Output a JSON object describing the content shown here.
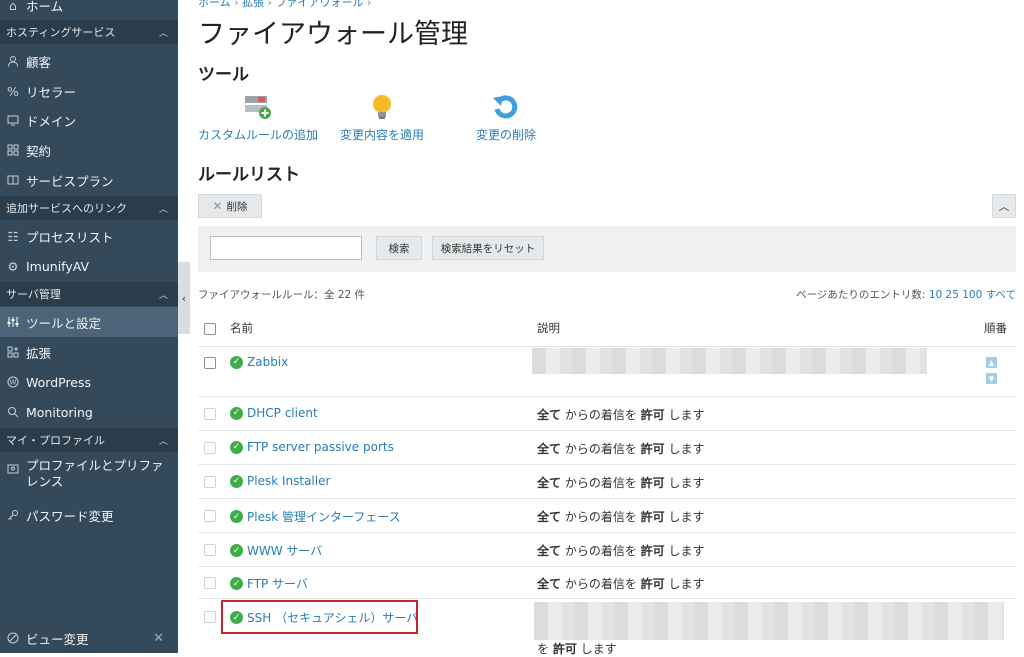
{
  "sidebar": {
    "top_item": "ホーム",
    "sections": [
      {
        "label": "ホスティングサービス"
      },
      {
        "label": "追加サービスへのリンク"
      },
      {
        "label": "サーバ管理"
      },
      {
        "label": "マイ・プロファイル"
      }
    ],
    "items": [
      {
        "label": "顧客",
        "icon": "user-icon"
      },
      {
        "label": "リセラー",
        "icon": "percent-icon"
      },
      {
        "label": "ドメイン",
        "icon": "monitor-icon"
      },
      {
        "label": "契約",
        "icon": "grid-icon"
      },
      {
        "label": "サービスプラン",
        "icon": "book-icon"
      },
      {
        "label": "プロセスリスト",
        "icon": "list-icon"
      },
      {
        "label": "ImunifyAV",
        "icon": "gear-icon"
      },
      {
        "label": "ツールと設定",
        "icon": "sliders-icon"
      },
      {
        "label": "拡張",
        "icon": "extensions-icon"
      },
      {
        "label": "WordPress",
        "icon": "wordpress-icon"
      },
      {
        "label": "Monitoring",
        "icon": "monitoring-icon"
      },
      {
        "label": "プロファイルとプリファ",
        "label2": "レンス",
        "icon": "profile-icon"
      },
      {
        "label": "パスワード変更",
        "icon": "key-icon"
      }
    ],
    "bottom_item": "ビュー変更"
  },
  "breadcrumb": [
    "ホーム",
    "拡張",
    "ファイアウォール"
  ],
  "page_title": "ファイアウォール管理",
  "tools_heading": "ツール",
  "tools": [
    {
      "label": "カスタムルールの追加",
      "icon": "add-rule-icon"
    },
    {
      "label": "変更内容を適用",
      "icon": "lightbulb-icon"
    },
    {
      "label": "変更の削除",
      "icon": "undo-icon"
    }
  ],
  "rules_heading": "ルールリスト",
  "delete_button": "削除",
  "search": {
    "value": "",
    "button": "検索",
    "reset_button": "検索結果をリセット"
  },
  "summary": "ファイアウォールルール：全 22 件",
  "per_page": {
    "label": "ページあたりのエントリ数:",
    "options": [
      "10",
      "25",
      "100",
      "すべて"
    ]
  },
  "columns": {
    "name": "名前",
    "description": "説明",
    "order": "順番"
  },
  "rows": [
    {
      "name": "Zabbix",
      "desc_a": "",
      "desc_b": "",
      "desc_c": "",
      "desc_d": ""
    },
    {
      "name": "DHCP client",
      "desc_a": "全て",
      "desc_b": " からの着信を ",
      "desc_c": "許可",
      "desc_d": " します"
    },
    {
      "name": "FTP server passive ports",
      "desc_a": "全て",
      "desc_b": " からの着信を ",
      "desc_c": "許可",
      "desc_d": " します"
    },
    {
      "name": "Plesk Installer",
      "desc_a": "全て",
      "desc_b": " からの着信を ",
      "desc_c": "許可",
      "desc_d": " します"
    },
    {
      "name": "Plesk 管理インターフェース",
      "desc_a": "全て",
      "desc_b": " からの着信を ",
      "desc_c": "許可",
      "desc_d": " します"
    },
    {
      "name": "WWW サーバ",
      "desc_a": "全て",
      "desc_b": " からの着信を ",
      "desc_c": "許可",
      "desc_d": " します"
    },
    {
      "name": "FTP サーバ",
      "desc_a": "全て",
      "desc_b": " からの着信を ",
      "desc_c": "許可",
      "desc_d": " します"
    },
    {
      "name": "SSH （セキュアシェル）サーバ",
      "desc_a": "",
      "desc_b": "を ",
      "desc_c": "許可",
      "desc_d": " します"
    }
  ],
  "colors": {
    "sidebar_bg": "#34495a",
    "section_bg": "#2b3c4a",
    "active_bg": "#4c6479",
    "link": "#2a7db2",
    "ok_green": "#3fae49",
    "highlight": "#c0262d"
  }
}
